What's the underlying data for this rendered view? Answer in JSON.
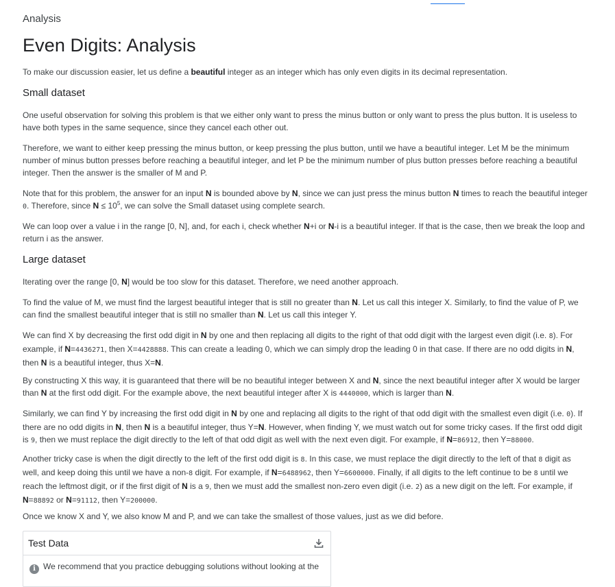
{
  "breadcrumb": "Analysis",
  "title": "Even Digits: Analysis",
  "intro": {
    "a": "To make our discussion easier, let us define a ",
    "bold": "beautiful",
    "b": " integer as an integer which has only even digits in its decimal representation."
  },
  "small_heading": "Small dataset",
  "small_p1": "One useful observation for solving this problem is that we either only want to press the minus button or only want to press the plus button. It is useless to have both types in the same sequence, since they cancel each other out.",
  "small_p2": "Therefore, we want to either keep pressing the minus button, or keep pressing the plus button, until we have a beautiful integer. Let M be the minimum number of minus button presses before reaching a beautiful integer, and let P be the minimum number of plus button presses before reaching a beautiful integer. Then the answer is the smaller of M and P.",
  "small_p3": {
    "a": "Note that for this problem, the answer for an input ",
    "n1": "N",
    "b": " is bounded above by ",
    "n2": "N",
    "c": ", since we can just press the minus button ",
    "n3": "N",
    "d": " times to reach the beautiful integer ",
    "zero": "0",
    "e": ". Therefore, since ",
    "n4": "N",
    "f": " ≤ 10",
    "exp": "5",
    "g": ", we can solve the Small dataset using complete search."
  },
  "small_p4": {
    "a": "We can loop over a value i in the range [0, N], and, for each i, check whether ",
    "n1": "N",
    "b": "+i or ",
    "n2": "N",
    "c": "-i is a beautiful integer. If that is the case, then we break the loop and return i as the answer."
  },
  "large_heading": "Large dataset",
  "large_p1": {
    "a": "Iterating over the range [0, ",
    "n": "N",
    "b": "] would be too slow for this dataset. Therefore, we need another approach."
  },
  "large_p2": {
    "a": "To find the value of M, we must find the largest beautiful integer that is still no greater than ",
    "n1": "N",
    "b": ". Let us call this integer X. Similarly, to find the value of P, we can find the smallest beautiful integer that is still no smaller than ",
    "n2": "N",
    "c": ". Let us call this integer Y."
  },
  "large_p3": {
    "a": "We can find X by decreasing the first odd digit in ",
    "n1": "N",
    "b": " by one and then replacing all digits to the right of that odd digit with the largest even digit (i.e. ",
    "eight": "8",
    "c": "). For example, if ",
    "n2": "N",
    "d": "=",
    "v1": "4436271",
    "e": ", then X=",
    "v2": "4428888",
    "f": ". This can create a leading 0, which we can simply drop the leading 0 in that case. If there are no odd digits in ",
    "n3": "N",
    "g": ", then ",
    "n4": "N",
    "h": " is a beautiful integer, thus X=",
    "n5": "N",
    "i": "."
  },
  "large_p4": {
    "a": "By constructing X this way, it is guaranteed that there will be no beautiful integer between X and ",
    "n1": "N",
    "b": ", since the next beautiful integer after X would be larger than ",
    "n2": "N",
    "c": " at the first odd digit. For the example above, the next beautiful integer after X is ",
    "v": "4440000",
    "d": ", which is larger than ",
    "n3": "N",
    "e": "."
  },
  "large_p5": {
    "a": "Similarly, we can find Y by increasing the first odd digit in ",
    "n1": "N",
    "b": " by one and replacing all digits to the right of that odd digit with the smallest even digit (i.e. ",
    "zero": "0",
    "c": "). If there are no odd digits in ",
    "n2": "N",
    "d": ", then ",
    "n3": "N",
    "e": " is a beautiful integer, thus Y=",
    "n4": "N",
    "f": ". However, when finding Y, we must watch out for some tricky cases. If the first odd digit is ",
    "nine": "9",
    "g": ", then we must replace the digit directly to the left of that odd digit as well with the next even digit. For example, if ",
    "n5": "N",
    "h": "=",
    "v1": "86912",
    "i": ", then Y=",
    "v2": "88000",
    "j": "."
  },
  "large_p6": {
    "a": "Another tricky case is when the digit directly to the left of the first odd digit is ",
    "e1": "8",
    "b": ". In this case, we must replace the digit directly to the left of that ",
    "e2": "8",
    "c": " digit as well, and keep doing this until we have a non-",
    "e3": "8",
    "d": " digit. For example, if ",
    "n1": "N",
    "e": "=",
    "v1": "6488962",
    "f": ", then Y=",
    "v2": "6600000",
    "g": ". Finally, if all digits to the left continue to be ",
    "e4": "8",
    "h": " until we reach the leftmost digit, or if the first digit of ",
    "n2": "N",
    "i": " is a ",
    "nine": "9",
    "j": ", then we must add the smallest non-zero even digit (i.e. ",
    "two": "2",
    "k": ") as a new digit on the left. For example, if ",
    "n3": "N",
    "l": "=",
    "v3": "88892",
    "m": " or ",
    "n4": "N",
    "n": "=",
    "v4": "91112",
    "o": ", then Y=",
    "v5": "200000",
    "p": "."
  },
  "large_p7": "Once we know X and Y, we also know M and P, and we can take the smallest of those values, just as we did before.",
  "test_data": {
    "title": "Test Data",
    "download_icon": "download-icon",
    "info_icon": "info-icon",
    "note": "We recommend that you practice debugging solutions without looking at the"
  }
}
